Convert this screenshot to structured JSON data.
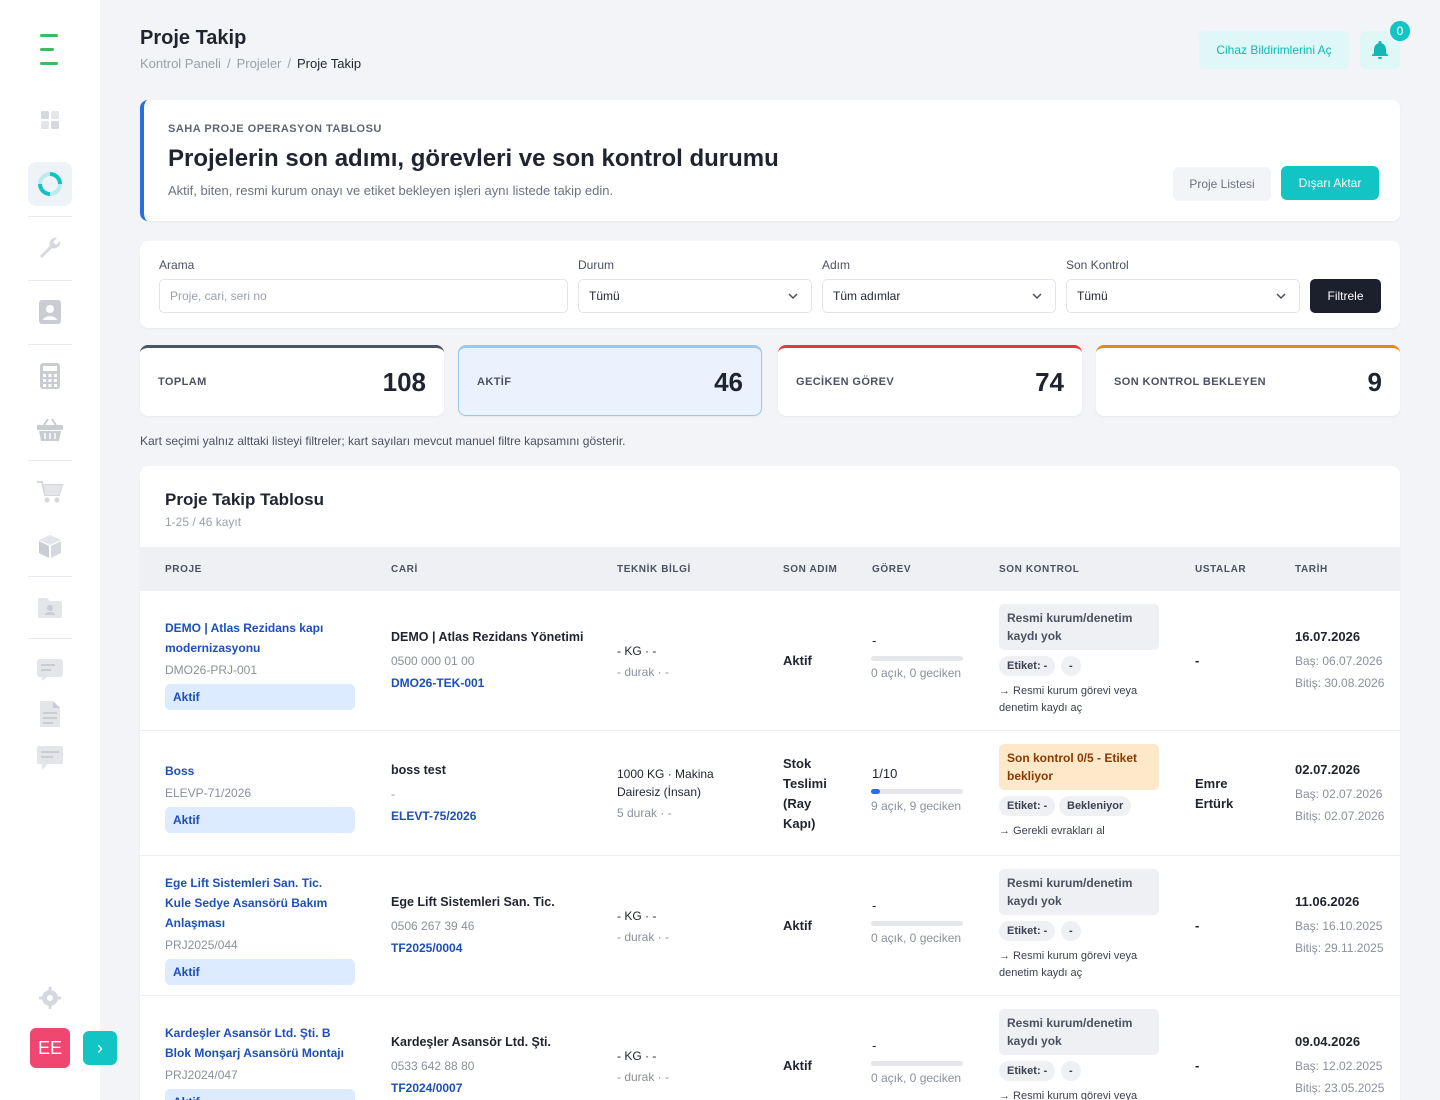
{
  "header": {
    "title": "Proje Takip",
    "breadcrumb": [
      "Kontrol Paneli",
      "Projeler",
      "Proje Takip"
    ],
    "device_button": "Cihaz Bildirimlerini Aç",
    "notification_count": "0"
  },
  "sidebar": {
    "avatar_initials": "EE",
    "icons": [
      "dashboard-icon",
      "chart-ring-icon",
      "wrench-icon",
      "contact-icon",
      "calculator-icon",
      "basket-icon",
      "cart-icon",
      "box-icon",
      "folder-user-icon",
      "message-icon",
      "document-icon",
      "chat-icon",
      "settings-icon"
    ]
  },
  "hero": {
    "kicker": "SAHA PROJE OPERASYON TABLOSU",
    "title": "Projelerin son adımı, görevleri ve son kontrol durumu",
    "subtitle": "Aktif, biten, resmi kurum onayı ve etiket bekleyen işleri aynı listede takip edin.",
    "btn_list": "Proje Listesi",
    "btn_export": "Dışarı Aktar"
  },
  "filters": {
    "search_label": "Arama",
    "search_placeholder": "Proje, cari, seri no",
    "status_label": "Durum",
    "status_value": "Tümü",
    "step_label": "Adım",
    "step_value": "Tüm adımlar",
    "last_check_label": "Son Kontrol",
    "last_check_value": "Tümü",
    "filter_button": "Filtrele"
  },
  "stats": [
    {
      "label": "TOPLAM",
      "value": "108",
      "color": "#4a5568"
    },
    {
      "label": "AKTİF",
      "value": "46",
      "color": "#9cc8ee"
    },
    {
      "label": "GECİKEN GÖREV",
      "value": "74",
      "color": "#e03a3a"
    },
    {
      "label": "SON KONTROL BEKLEYEN",
      "value": "9",
      "color": "#e08a14"
    }
  ],
  "note": "Kart seçimi yalnız alttaki listeyi filtreler; kart sayıları mevcut manuel filtre kapsamını gösterir.",
  "table": {
    "title": "Proje Takip Tablosu",
    "subtitle": "1-25 / 46 kayıt",
    "columns": [
      "PROJE",
      "CARİ",
      "TEKNİK BİLGİ",
      "SON ADIM",
      "GÖREV",
      "SON KONTROL",
      "USTALAR",
      "TARİH"
    ],
    "rows": [
      {
        "name_lines": [
          "DEMO | Atlas Rezidans kapı",
          "modernizasyonu"
        ],
        "code": "DMO26-PRJ-001",
        "status": "Aktif",
        "cari": "DEMO | Atlas Rezidans Yönetimi",
        "phone": "0500 000 01 00",
        "ref": "DMO26-TEK-001",
        "tech1": "- KG · -",
        "tech2": "- durak · -",
        "step_lines": [
          "Aktif"
        ],
        "task": "-",
        "task_progress": 0,
        "task_meta": "0 açık, 0 geciken",
        "check_lines": [
          "Resmi kurum/denetim",
          "kaydı yok"
        ],
        "check_warn": false,
        "chip1": "Etiket: -",
        "chip2": "-",
        "hint": "→ Resmi kurum görevi veya denetim kaydı aç",
        "workers_lines": [
          "-"
        ],
        "date": "16.07.2026",
        "start": "Baş: 06.07.2026",
        "end": "Bitiş: 30.08.2026"
      },
      {
        "name_lines": [
          "Boss"
        ],
        "code": "ELEVP-71/2026",
        "status": "Aktif",
        "cari": "boss test",
        "phone": "-",
        "ref": "ELEVT-75/2026",
        "tech1": "1000 KG · Makina",
        "tech1b": "Dairesiz (İnsan)",
        "tech2": "5 durak · -",
        "step_lines": [
          "Stok",
          "Teslimi",
          "(Ray",
          "Kapı)"
        ],
        "task": "1/10",
        "task_progress": 0.1,
        "task_meta": "9 açık, 9 geciken",
        "check_lines": [
          "Son kontrol 0/5 - Etiket",
          "bekliyor"
        ],
        "check_warn": true,
        "chip1": "Etiket: -",
        "chip2": "Bekleniyor",
        "hint": "→ Gerekli evrakları al",
        "workers_lines": [
          "Emre",
          "Ertürk"
        ],
        "date": "02.07.2026",
        "start": "Baş: 02.07.2026",
        "end": "Bitiş: 02.07.2026"
      },
      {
        "name_lines": [
          "Ege Lift Sistemleri San. Tic.",
          "Kule Sedye Asansörü Bakım",
          "Anlaşması"
        ],
        "code": "PRJ2025/044",
        "status": "Aktif",
        "cari": "Ege Lift Sistemleri San. Tic.",
        "phone": "0506 267 39 46",
        "ref": "TF2025/0004",
        "tech1": "- KG · -",
        "tech2": "- durak · -",
        "step_lines": [
          "Aktif"
        ],
        "task": "-",
        "task_progress": 0,
        "task_meta": "0 açık, 0 geciken",
        "check_lines": [
          "Resmi kurum/denetim",
          "kaydı yok"
        ],
        "check_warn": false,
        "chip1": "Etiket: -",
        "chip2": "-",
        "hint": "→ Resmi kurum görevi veya denetim kaydı aç",
        "workers_lines": [
          "-"
        ],
        "date": "11.06.2026",
        "start": "Baş: 16.10.2025",
        "end": "Bitiş: 29.11.2025"
      },
      {
        "name_lines": [
          "Kardeşler Asansör Ltd. Şti. B",
          "Blok Monşarj Asansörü Montajı"
        ],
        "code": "PRJ2024/047",
        "status": "Aktif",
        "cari": "Kardeşler Asansör Ltd. Şti.",
        "phone": "0533 642 88 80",
        "ref": "TF2024/0007",
        "tech1": "- KG · -",
        "tech2": "- durak · -",
        "step_lines": [
          "Aktif"
        ],
        "task": "-",
        "task_progress": 0,
        "task_meta": "0 açık, 0 geciken",
        "check_lines": [
          "Resmi kurum/denetim",
          "kaydı yok"
        ],
        "check_warn": false,
        "chip1": "Etiket: -",
        "chip2": "-",
        "hint": "→ Resmi kurum görevi veya",
        "workers_lines": [
          "-"
        ],
        "date": "09.04.2026",
        "start": "Baş: 12.02.2025",
        "end": "Bitiş: 23.05.2025"
      }
    ]
  }
}
